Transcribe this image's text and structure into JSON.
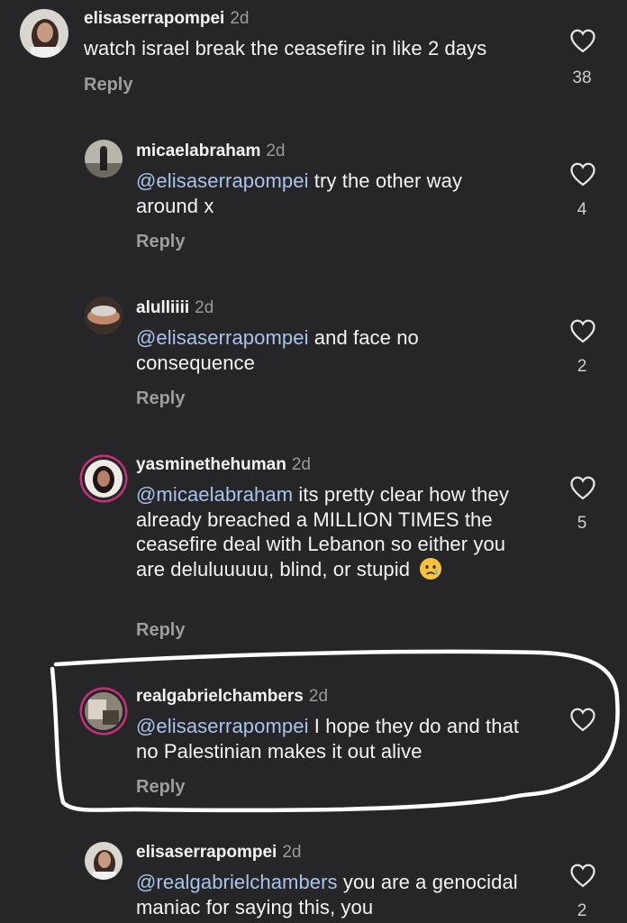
{
  "comments": [
    {
      "username": "elisaserrapompei",
      "time": "2d",
      "mention": "",
      "text": "watch israel break the ceasefire in like 2 days",
      "reply_label": "Reply",
      "likes": "38",
      "avatar_icon": "profile-photo-icon"
    },
    {
      "username": "micaelabraham",
      "time": "2d",
      "mention": "@elisaserrapompei",
      "text": " try the other way around x",
      "reply_label": "Reply",
      "likes": "4",
      "avatar_icon": "profile-photo-icon"
    },
    {
      "username": "alulliiii",
      "time": "2d",
      "mention": "@elisaserrapompei",
      "text": " and face no consequence",
      "reply_label": "Reply",
      "likes": "2",
      "avatar_icon": "profile-photo-icon"
    },
    {
      "username": "yasminethehuman",
      "time": "2d",
      "mention": "@micaelabraham",
      "text": " its pretty clear how they already breached a MILLION TIMES the ceasefire deal with Lebanon so either you are deluluuuuu, blind, or stupid",
      "emoji": "crying-face-emoji",
      "reply_label": "Reply",
      "likes": "5",
      "avatar_icon": "profile-photo-icon"
    },
    {
      "username": "realgabrielchambers",
      "time": "2d",
      "mention": "@elisaserrapompei",
      "text": " I hope they do and that no Palestinian makes it out alive",
      "reply_label": "Reply",
      "likes": "",
      "avatar_icon": "profile-photo-icon"
    },
    {
      "username": "elisaserrapompei",
      "time": "2d",
      "mention": "@realgabrielchambers",
      "text": " you are a genocidal maniac for saying this, you",
      "reply_label": "",
      "likes": "2",
      "avatar_icon": "profile-photo-icon"
    }
  ],
  "colors": {
    "background": "#262628",
    "mention": "#a9c4ec",
    "muted": "#9d9da0",
    "story_ring": "#c6307a",
    "highlight_stroke": "#ffffff"
  },
  "icons": {
    "like": "heart-outline-icon",
    "annotation": "hand-drawn-highlight-outline"
  }
}
